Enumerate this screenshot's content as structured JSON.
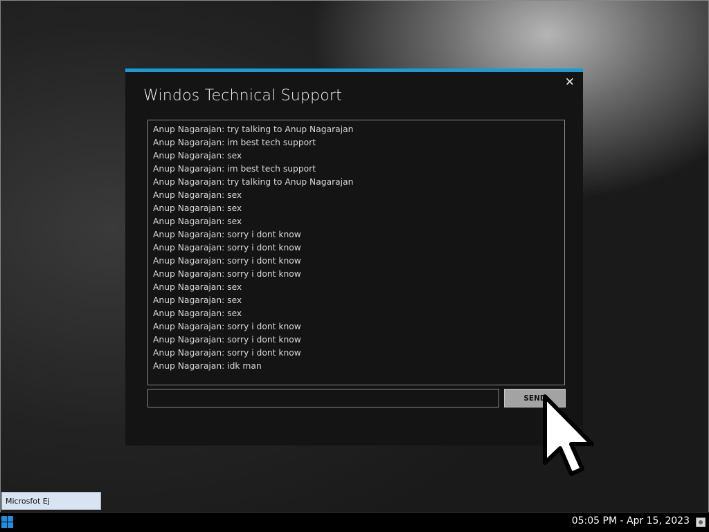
{
  "window": {
    "title": "Windos Technical Support",
    "close_glyph": "✕",
    "accent_color": "#1a9bd6"
  },
  "chat_log": [
    "Anup Nagarajan: try talking to Anup Nagarajan",
    "Anup Nagarajan: im best tech support",
    "Anup Nagarajan: sex",
    "Anup Nagarajan: im best tech support",
    "Anup Nagarajan: try talking to Anup Nagarajan",
    "Anup Nagarajan: sex",
    "Anup Nagarajan: sex",
    "Anup Nagarajan: sex",
    "Anup Nagarajan: sorry i dont know",
    "Anup Nagarajan: sorry i dont know",
    "Anup Nagarajan: sorry i dont know",
    "Anup Nagarajan: sorry i dont know",
    "Anup Nagarajan: sex",
    "Anup Nagarajan: sex",
    "Anup Nagarajan: sex",
    "Anup Nagarajan: sorry i dont know",
    "Anup Nagarajan: sorry i dont know",
    "Anup Nagarajan: sorry i dont know",
    "Anup Nagarajan: idk man"
  ],
  "message_input": {
    "value": "",
    "placeholder": ""
  },
  "send_button": {
    "label": "SEND"
  },
  "taskbar": {
    "window_button_label": "Microsfot Ej",
    "clock": "05:05 PM - Apr 15, 2023",
    "start_icon": "windows-logo-icon",
    "tray_icon": "system-tray-icon"
  }
}
